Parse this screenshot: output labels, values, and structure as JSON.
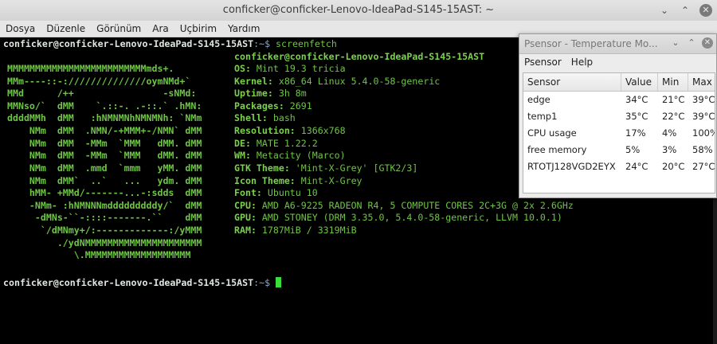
{
  "window": {
    "title": "conficker@conficker-Lenovo-IdeaPad-S145-15AST: ~",
    "minimize_glyph": "⌄",
    "maximize_glyph": "⌃",
    "close_glyph": "✕"
  },
  "menubar": {
    "items": [
      "Dosya",
      "Düzenle",
      "Görünüm",
      "Ara",
      "Uçbirim",
      "Yardım"
    ]
  },
  "terminal": {
    "prompt_user": "conficker@conficker-Lenovo-IdeaPad-S145-15AST",
    "prompt_path": ":~$",
    "command": " screenfetch",
    "art": [
      "MMMMMMMMMMMMMMMMMMMMMMMMMmds+.",
      "MMm----::-://////////////oymNMd+`",
      "MMd      /++                -sNMd:",
      "MMNso/`  dMM    `.::-. .-::.` .hMN:",
      "ddddMMh  dMM   :hNMNMNhNMNMNh: `NMm",
      "    NMm  dMM  .NMN/-+MMM+-/NMN` dMM",
      "    NMm  dMM  -MMm  `MMM   dMM. dMM",
      "    NMm  dMM  -MMm  `MMM   dMM. dMM",
      "    NMm  dMM  .mmd  `mmm   yMM. dMM",
      "    NMm  dMM`  ..`   ...   ydm. dMM",
      "    hMM- +MMd/-------...-:sdds  dMM",
      "    -NMm- :hNMNNNmdddddddddy/`  dMM",
      "     -dMNs-``-::::-------.``    dMM",
      "      `/dMNmy+/:-------------:/yMMM",
      "         ./ydNMMMMMMMMMMMMMMMMMMMMM",
      "            \\.MMMMMMMMMMMMMMMMMMM"
    ],
    "info_header": "conficker@conficker-Lenovo-IdeaPad-S145-15AST",
    "info": [
      {
        "key": "OS:",
        "value": " Mint 19.3 tricia"
      },
      {
        "key": "Kernel:",
        "value": " x86_64 Linux 5.4.0-58-generic"
      },
      {
        "key": "Uptime:",
        "value": " 3h 8m"
      },
      {
        "key": "Packages:",
        "value": " 2691"
      },
      {
        "key": "Shell:",
        "value": " bash"
      },
      {
        "key": "Resolution:",
        "value": " 1366x768"
      },
      {
        "key": "DE:",
        "value": " MATE 1.22.2"
      },
      {
        "key": "WM:",
        "value": " Metacity (Marco)"
      },
      {
        "key": "GTK Theme:",
        "value": " 'Mint-X-Grey' [GTK2/3]"
      },
      {
        "key": "Icon Theme:",
        "value": " Mint-X-Grey"
      },
      {
        "key": "Font:",
        "value": " Ubuntu 10"
      },
      {
        "key": "CPU:",
        "value": " AMD A6-9225 RADEON R4, 5 COMPUTE CORES 2C+3G @ 2x 2.6GHz"
      },
      {
        "key": "GPU:",
        "value": " AMD STONEY (DRM 3.35.0, 5.4.0-58-generic, LLVM 10.0.1)"
      },
      {
        "key": "RAM:",
        "value": " 1787MiB / 3319MiB"
      }
    ]
  },
  "psensor": {
    "title": "Psensor - Temperature Mo...",
    "minimize_glyph": "⌄",
    "maximize_glyph": "⌃",
    "close_glyph": "✕",
    "menu": [
      "Psensor",
      "Help"
    ],
    "columns": [
      "Sensor",
      "Value",
      "Min",
      "Max"
    ],
    "rows": [
      [
        "edge",
        "34°C",
        "21°C",
        "39°C"
      ],
      [
        "temp1",
        "35°C",
        "22°C",
        "39°C"
      ],
      [
        "CPU usage",
        "17%",
        "4%",
        "100%"
      ],
      [
        "free memory",
        "5%",
        "3%",
        "58%"
      ],
      [
        "RTOTJ128VGD2EYX",
        "24°C",
        "20°C",
        "27°C"
      ]
    ]
  },
  "colors": {
    "terminal_bg": "#000000",
    "text_green": "#78d13c",
    "cursor": "#3ade3a"
  }
}
